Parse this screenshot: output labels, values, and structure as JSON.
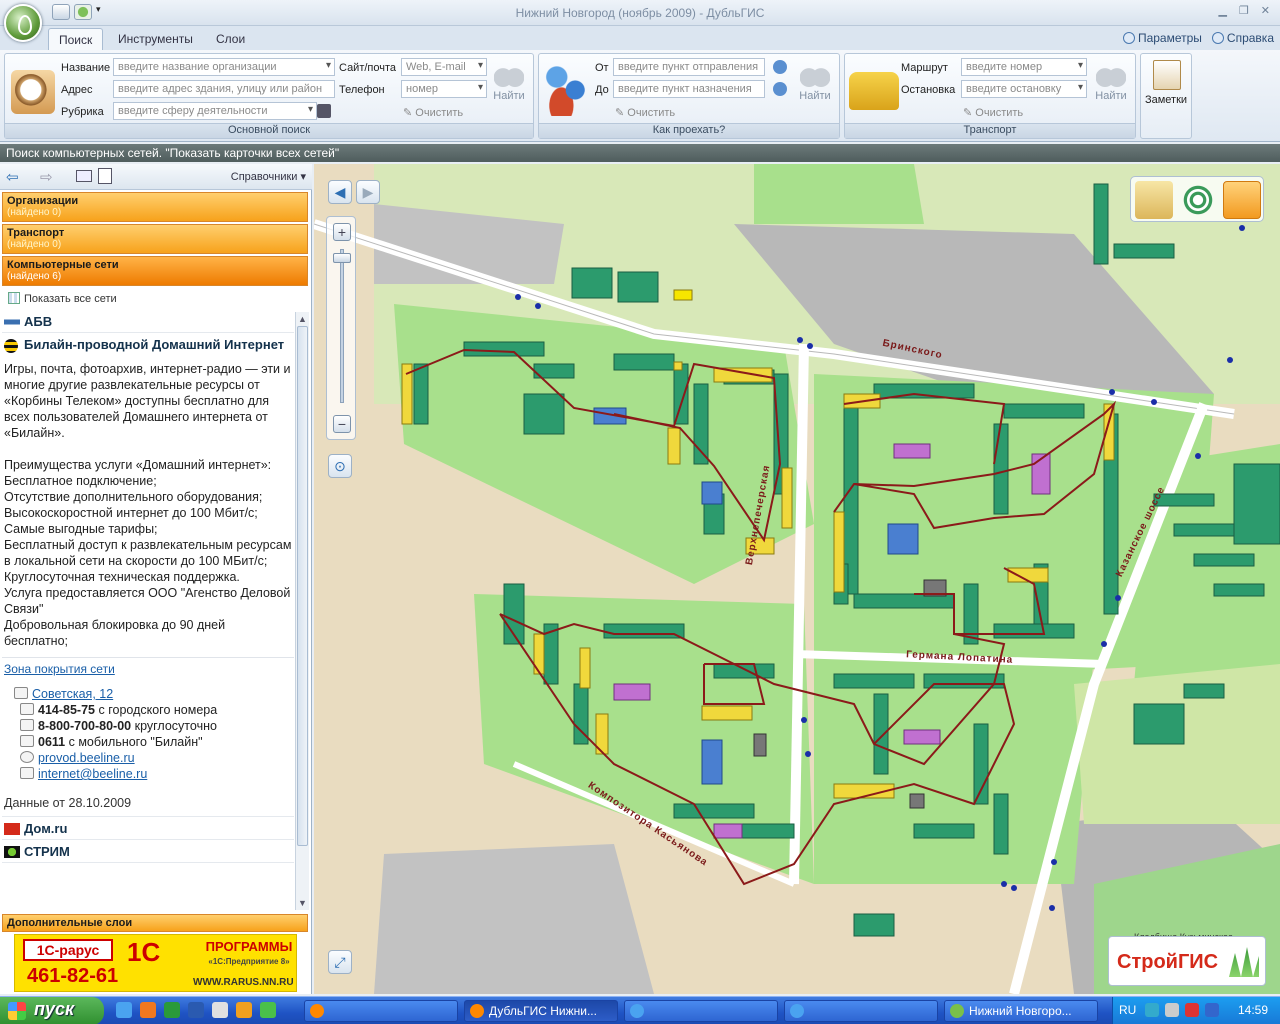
{
  "window": {
    "title": "Нижний Новгород (ноябрь 2009) - ДубльГИС"
  },
  "ribbon": {
    "tabs": [
      "Поиск",
      "Инструменты",
      "Слои"
    ],
    "right_links": {
      "params": "Параметры",
      "help": "Справка"
    },
    "basic_search": {
      "label_name": "Название",
      "name_placeholder": "введите название организации",
      "label_address": "Адрес",
      "address_placeholder": "введите адрес здания, улицу или район",
      "label_rubric": "Рубрика",
      "rubric_placeholder": "введите сферу деятельности",
      "label_site": "Сайт/почта",
      "site_placeholder": "Web, E-mail",
      "label_phone": "Телефон",
      "phone_placeholder": "номер",
      "clear": "Очистить",
      "find": "Найти",
      "group_label": "Основной поиск"
    },
    "route": {
      "label_from": "От",
      "from_placeholder": "введите пункт отправления",
      "label_to": "До",
      "to_placeholder": "введите пункт назначения",
      "clear": "Очистить",
      "find": "Найти",
      "group_label": "Как проехать?"
    },
    "transport": {
      "label_route": "Маршрут",
      "route_placeholder": "введите номер",
      "label_stop": "Остановка",
      "stop_placeholder": "введите остановку",
      "clear": "Очистить",
      "find": "Найти",
      "group_label": "Транспорт"
    },
    "notes": {
      "label": "Заметки"
    }
  },
  "status": {
    "text": "Поиск компьютерных сетей. \"Показать карточки всех сетей\""
  },
  "left_panel": {
    "reference": "Справочники",
    "categories": [
      {
        "title": "Организации",
        "count": "(найдено 0)"
      },
      {
        "title": "Транспорт",
        "count": "(найдено 0)"
      },
      {
        "title": "Компьютерные сети",
        "count": "(найдено 6)"
      }
    ],
    "show_all": "Показать все сети",
    "networks": {
      "abv": "АБВ",
      "beeline": "Билайн-проводной Домашний Интернет",
      "dom": "Дом.ru",
      "strim": "СТРИМ"
    },
    "description": {
      "intro": "Игры, почта, фотоархив, интернет-радио — эти и многие другие развлекательные ресурсы от «Корбины Телеком» доступны бесплатно для всех пользователей Домашнего интернета от «Билайн».",
      "lines": [
        "Преимущества услуги «Домашний интернет»:",
        "Бесплатное подключение;",
        "Отсутствие дополнительного оборудования;",
        "Высокоскоростной интернет до 100 Мбит/с;",
        "Самые выгодные тарифы;",
        "Бесплатный доступ к развлекательным ресурсам",
        "в локальной сети на скорости до 100 МБит/с;",
        "Круглосуточная техническая поддержка.",
        "Услуга предоставляется ООО \"Агенство Деловой Связи\"",
        "Добровольная блокировка до 90 дней бесплатно;"
      ]
    },
    "coverage_link": "Зона покрытия сети",
    "address": "Советская, 12",
    "phones": [
      {
        "num": "414-85-75",
        "note": "с городского номера"
      },
      {
        "num": "8-800-700-80-00",
        "note": "круглосуточно"
      },
      {
        "num": "0611",
        "note": "с мобильного \"Билайн\""
      }
    ],
    "site": "provod.beeline.ru",
    "email": "internet@beeline.ru",
    "data_date": "Данные от 28.10.2009",
    "extra_layers": "Дополнительные слои",
    "ad": {
      "brand": "1С-рарус",
      "phone": "461-82-61",
      "oneC": "1С",
      "programs": "ПРОГРАММЫ",
      "programs_sub": "«1С:Предприятие 8»",
      "url": "WWW.RARUS.NN.RU"
    }
  },
  "map": {
    "streets": {
      "brinskogo": "Бринского",
      "verkhnepechorskaya": "Верхнепечерская",
      "kazanskoe": "Казанское шоссе",
      "germana": "Германа Лопатина",
      "kasyanova": "Композитора Касьянова"
    },
    "cemetery": "Кладбище Кузьминское",
    "brand": "СтройГИС"
  },
  "taskbar": {
    "start": "пуск",
    "tasks": [
      "",
      "ДубльГИС Нижни...",
      "",
      "",
      "Нижний Новгоро..."
    ],
    "lang": "RU",
    "clock": "14:59"
  },
  "colors": {
    "map_bg": "#d7e8b8",
    "residential": "#a8e08c",
    "building": "#2c9b6d",
    "network_line": "#8b1a1a",
    "highlight": "#f0d83c",
    "road": "#ffffff"
  }
}
